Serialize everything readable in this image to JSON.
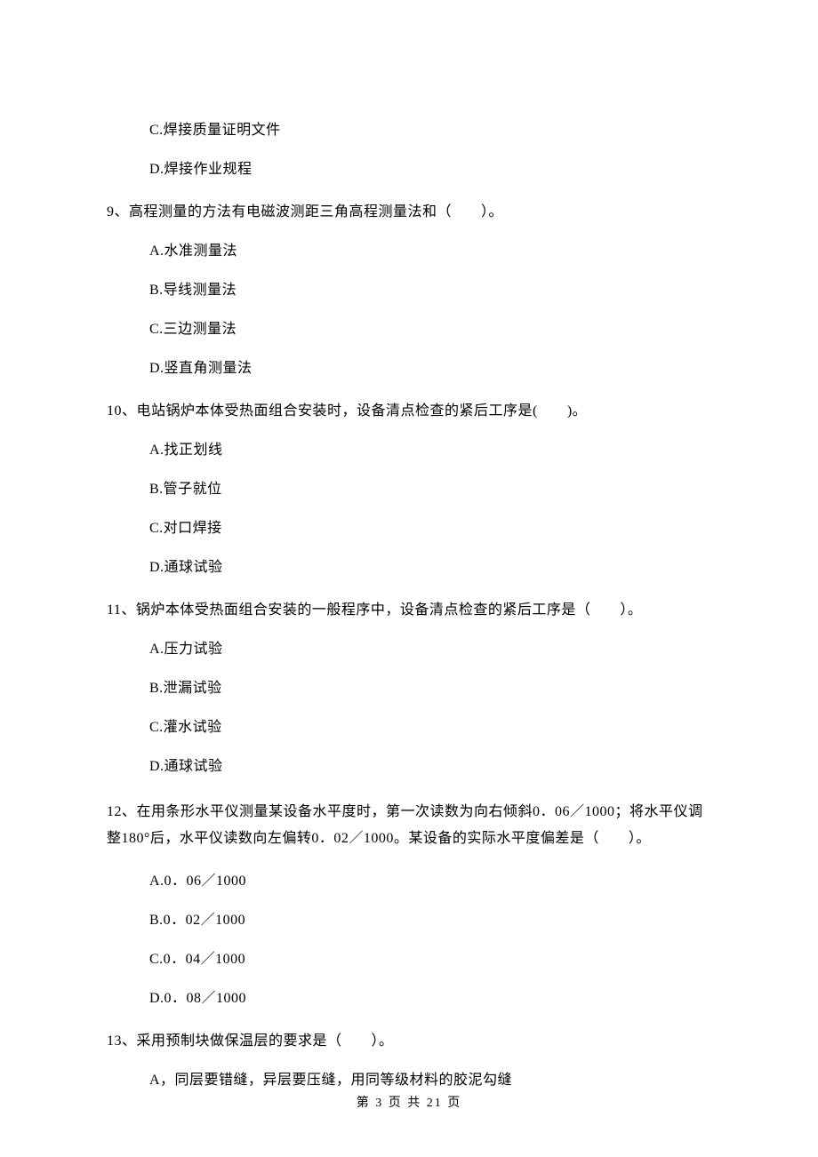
{
  "q8": {
    "options": {
      "c": "C.焊接质量证明文件",
      "d": "D.焊接作业规程"
    }
  },
  "q9": {
    "stem": "9、高程测量的方法有电磁波测距三角高程测量法和（　　）。",
    "options": {
      "a": "A.水准测量法",
      "b": "B.导线测量法",
      "c": "C.三边测量法",
      "d": "D.竖直角测量法"
    }
  },
  "q10": {
    "stem": "10、电站锅炉本体受热面组合安装时，设备清点检查的紧后工序是(　　)。",
    "options": {
      "a": "A.找正划线",
      "b": "B.管子就位",
      "c": "C.对口焊接",
      "d": "D.通球试验"
    }
  },
  "q11": {
    "stem": "11、锅炉本体受热面组合安装的一般程序中，设备清点检查的紧后工序是（　　）。",
    "options": {
      "a": "A.压力试验",
      "b": "B.泄漏试验",
      "c": "C.灌水试验",
      "d": "D.通球试验"
    }
  },
  "q12": {
    "stem": "12、在用条形水平仪测量某设备水平度时，第一次读数为向右倾斜0．06／1000；将水平仪调整180°后，水平仪读数向左偏转0．02／1000。某设备的实际水平度偏差是（　　）。",
    "options": {
      "a": "A.0．06／1000",
      "b": "B.0．02／1000",
      "c": "C.0．04／1000",
      "d": "D.0．08／1000"
    }
  },
  "q13": {
    "stem": "13、采用预制块做保温层的要求是（　　）。",
    "options": {
      "a": "A，同层要错缝，异层要压缝，用同等级材料的胶泥勾缝"
    }
  },
  "footer": "第 3 页 共 21 页"
}
